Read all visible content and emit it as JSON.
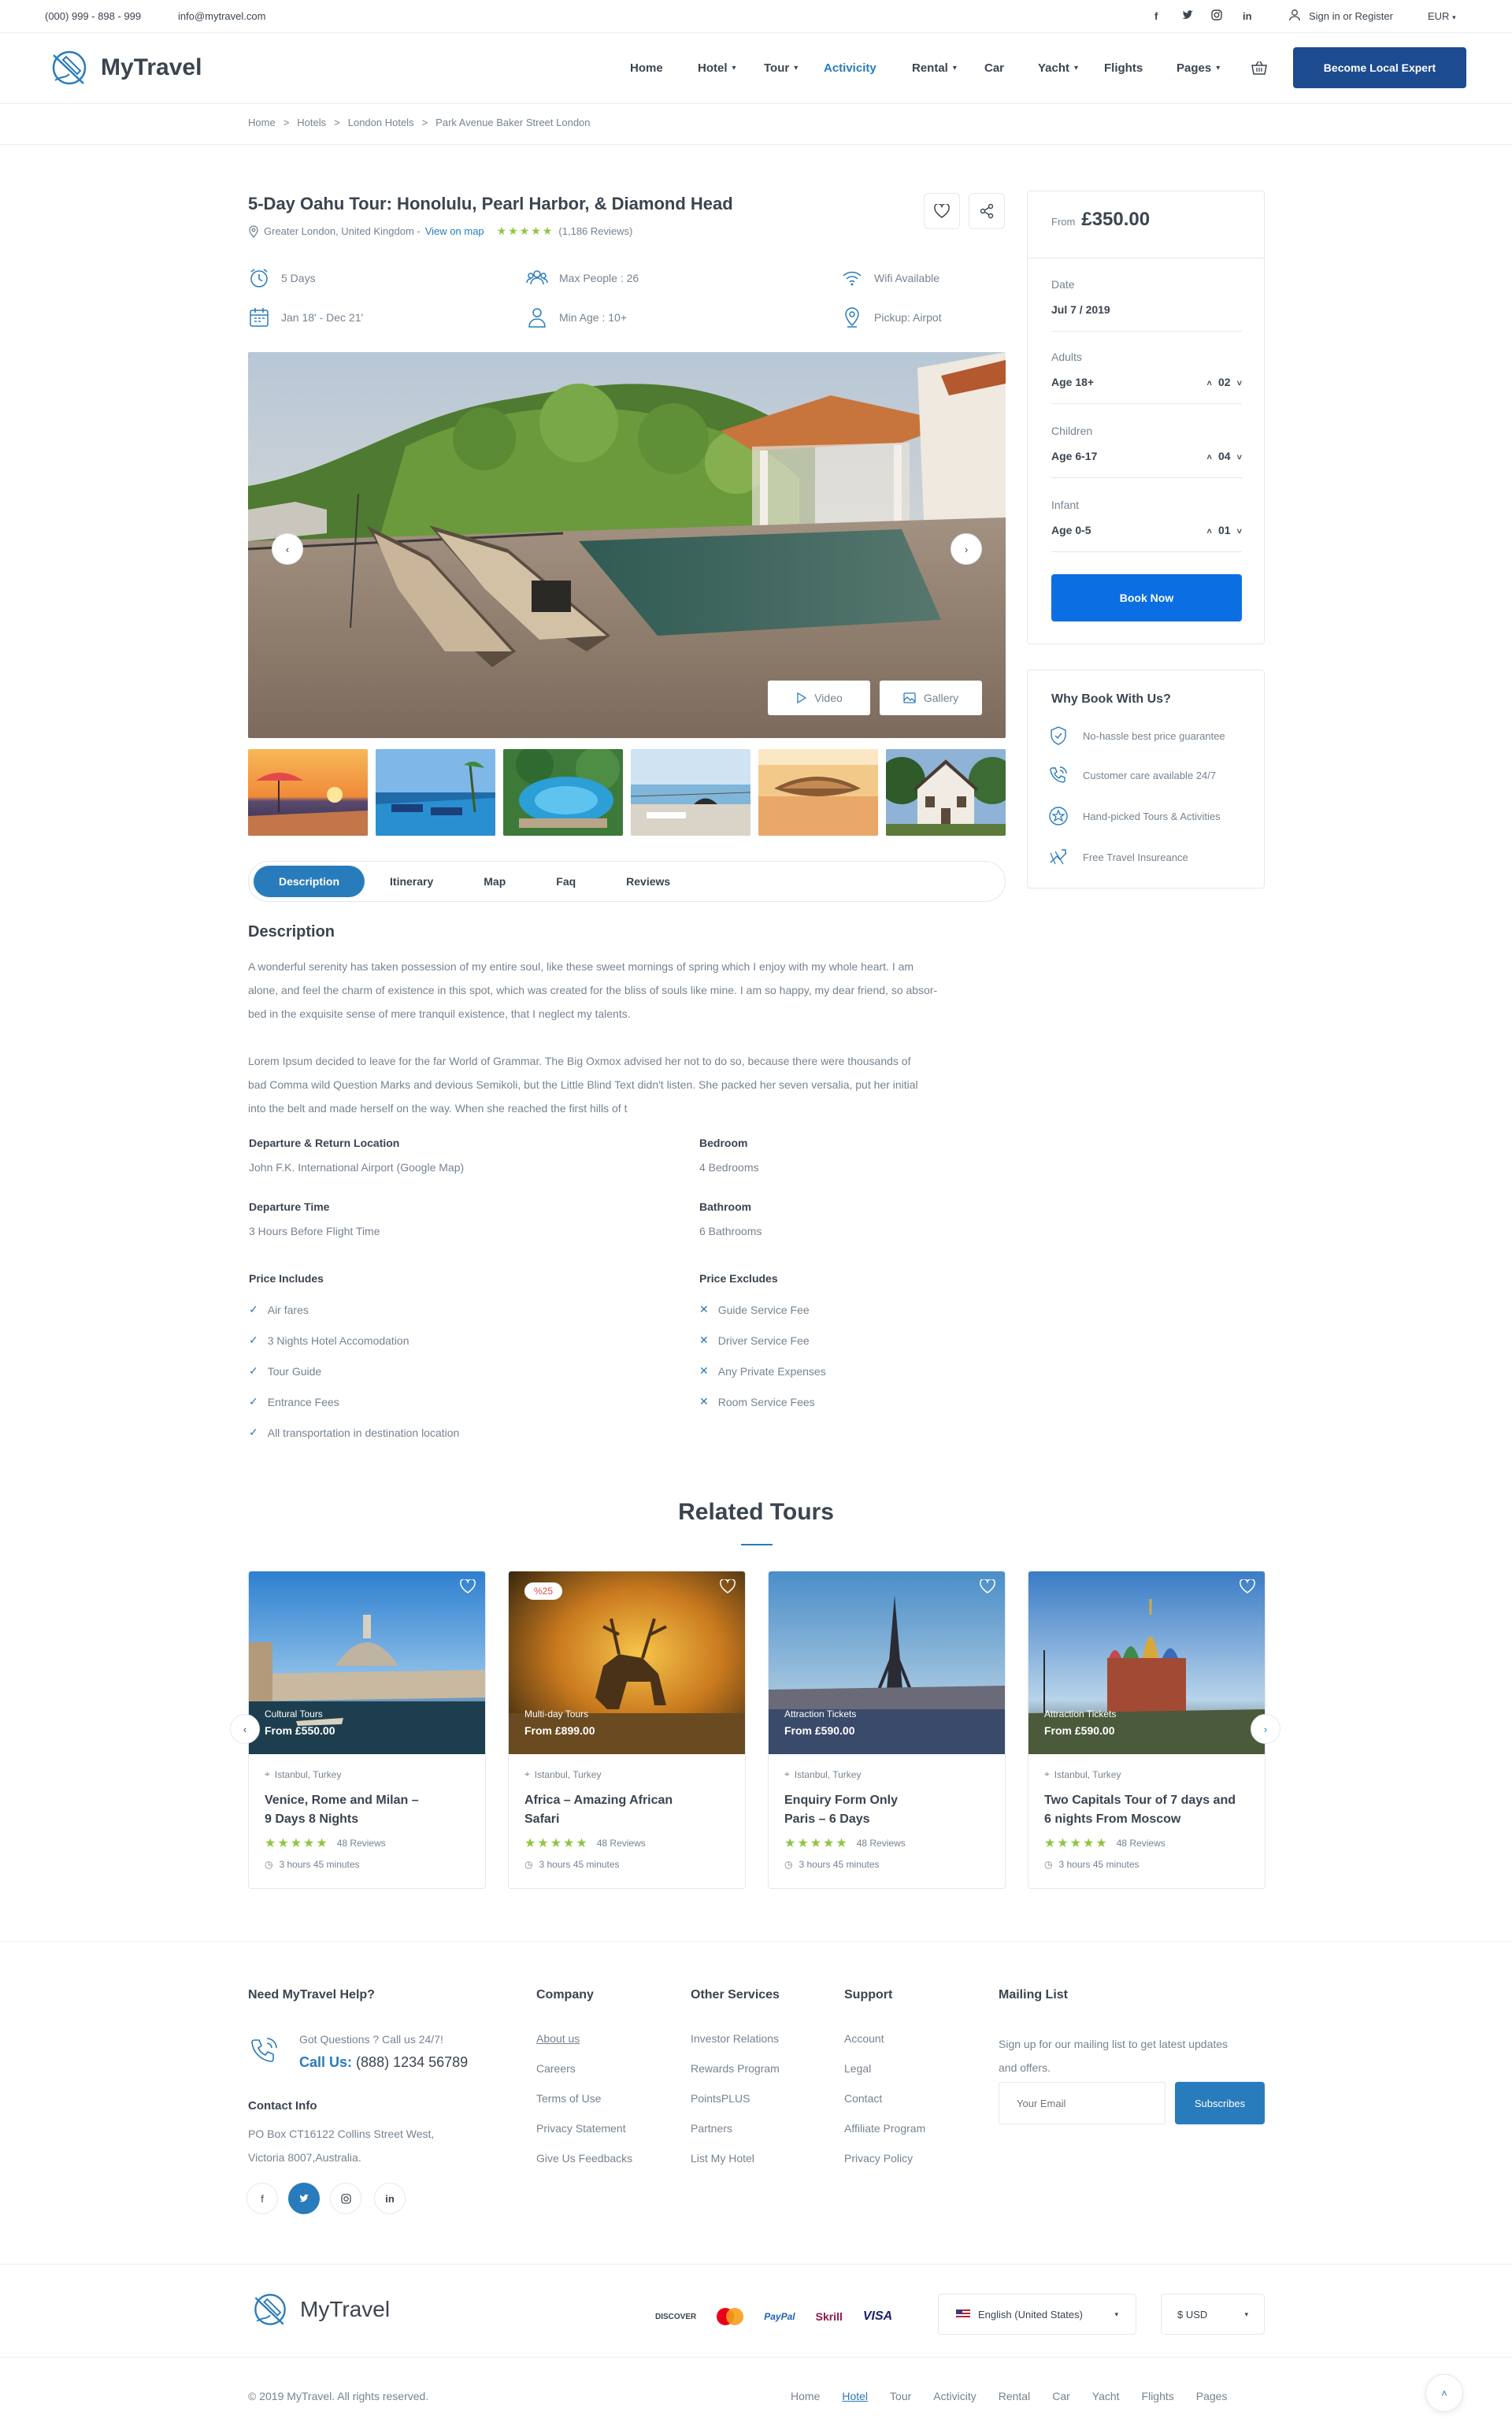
{
  "topbar": {
    "phone": "(000) 999 - 898 - 999",
    "email": "info@mytravel.com",
    "signin": "Sign in or Register",
    "currency": "EUR"
  },
  "header": {
    "logo": "MyTravel",
    "nav": [
      {
        "label": "Home"
      },
      {
        "label": "Hotel"
      },
      {
        "label": "Tour"
      },
      {
        "label": "Activicity"
      },
      {
        "label": "Rental"
      },
      {
        "label": "Car"
      },
      {
        "label": "Yacht"
      },
      {
        "label": "Flights"
      },
      {
        "label": "Pages"
      }
    ],
    "cta": "Become Local Expert"
  },
  "breadcrumb": [
    "Home",
    "Hotels",
    "London Hotels",
    "Park Avenue Baker Street London"
  ],
  "tour": {
    "title": "5-Day Oahu Tour: Honolulu, Pearl Harbor, & Diamond Head",
    "location": "Greater London, United Kingdom -",
    "view_map": "View on map",
    "reviews": "(1,186 Reviews)",
    "features": {
      "days": "5 Days",
      "people": "Max People : 26",
      "wifi": "Wifi Available",
      "dates": "Jan 18' - Dec 21'",
      "age": "Min Age : 10+",
      "pickup": "Pickup: Airpot"
    },
    "video_btn": "Video",
    "gallery_btn": "Gallery"
  },
  "tabs": [
    "Description",
    "Itinerary",
    "Map",
    "Faq",
    "Reviews"
  ],
  "description": {
    "heading": "Description",
    "para1_l1": "A wonderful serenity has taken possession of my entire soul, like these sweet mornings of spring which I enjoy with my whole heart. I am",
    "para1_l2": "alone, and feel the charm of existence in this spot, which was created for the bliss of souls like mine. I am so happy, my dear friend, so absor-",
    "para1_l3": "bed in the exquisite sense of mere tranquil existence, that I neglect my talents.",
    "para2_l1": "Lorem Ipsum decided to leave for the far World of Grammar. The Big Oxmox advised her not to do so, because there were thousands of",
    "para2_l2": "bad Comma wild Question Marks and devious Semikoli, but the Little Blind Text didn't listen. She packed her seven versalia, put her initial",
    "para2_l3": "into the belt and made herself on the way. When she reached the first hills of t",
    "departure_label": "Departure & Return Location",
    "departure_value": "John F.K. International Airport (Google Map)",
    "bedroom_label": "Bedroom",
    "bedroom_value": "4 Bedrooms",
    "dep_time_label": "Departure Time",
    "dep_time_value": "3 Hours Before Flight Time",
    "bathroom_label": "Bathroom",
    "bathroom_value": "6 Bathrooms",
    "includes_label": "Price Includes",
    "includes": [
      "Air fares",
      "3 Nights Hotel Accomodation",
      "Tour Guide",
      "Entrance Fees",
      "All transportation in destination location"
    ],
    "excludes_label": "Price Excludes",
    "excludes": [
      "Guide Service Fee",
      "Driver Service Fee",
      "Any Private Expenses",
      "Room Service Fees"
    ]
  },
  "booking": {
    "from": "From",
    "price": "£350.00",
    "date_label": "Date",
    "date_value": "Jul 7 / 2019",
    "adults_label": "Adults",
    "adults_age": "Age 18+",
    "adults_count": "02",
    "children_label": "Children",
    "children_age": "Age 6-17",
    "children_count": "04",
    "infant_label": "Infant",
    "infant_age": "Age 0-5",
    "infant_count": "01",
    "book_btn": "Book Now"
  },
  "why": {
    "title": "Why Book With Us?",
    "items": [
      "No-hassle best price guarantee",
      "Customer care available 24/7",
      "Hand-picked Tours & Activities",
      "Free Travel Insureance"
    ]
  },
  "related": {
    "title": "Related Tours",
    "cards": [
      {
        "category": "Cultural Tours",
        "price_prefix": "From",
        "price": "£550.00",
        "location": "Istanbul, Turkey",
        "title_l1": "Venice, Rome and Milan –",
        "title_l2": "9 Days 8 Nights",
        "reviews": "48 Reviews",
        "duration": "3 hours 45 minutes",
        "badge": ""
      },
      {
        "category": "Multi-day Tours",
        "price_prefix": "From",
        "price": "£899.00",
        "location": "Istanbul, Turkey",
        "title_l1": "Africa – Amazing African",
        "title_l2": "Safari",
        "reviews": "48 Reviews",
        "duration": "3 hours 45 minutes",
        "badge": "%25"
      },
      {
        "category": "Attraction Tickets",
        "price_prefix": "From",
        "price": "£590.00",
        "location": "Istanbul, Turkey",
        "title_l1": "Enquiry Form Only",
        "title_l2": "Paris – 6 Days",
        "reviews": "48 Reviews",
        "duration": "3 hours 45 minutes",
        "badge": ""
      },
      {
        "category": "Attraction Tickets",
        "price_prefix": "From",
        "price": "£590.00",
        "location": "Istanbul, Turkey",
        "title_l1": "Two Capitals Tour of 7 days and",
        "title_l2": "6 nights From Moscow",
        "reviews": "48 Reviews",
        "duration": "3 hours 45 minutes",
        "badge": ""
      }
    ]
  },
  "footer": {
    "help_title": "Need MyTravel Help?",
    "questions": "Got Questions ? Call us 24/7!",
    "call_label": "Call Us:",
    "call_number": "(888) 1234 56789",
    "contact_title": "Contact Info",
    "address_l1": "PO Box CT16122 Collins Street West,",
    "address_l2": "Victoria 8007,Australia.",
    "company_title": "Company",
    "company": [
      "About us",
      "Careers",
      "Terms of Use",
      "Privacy Statement",
      "Give Us Feedbacks"
    ],
    "services_title": "Other Services",
    "services": [
      "Investor Relations",
      "Rewards Program",
      "PointsPLUS",
      "Partners",
      "List My Hotel"
    ],
    "support_title": "Support",
    "support": [
      "Account",
      "Legal",
      "Contact",
      "Affiliate Program",
      "Privacy Policy"
    ],
    "mailing_title": "Mailing List",
    "mailing_l1": "Sign up for our mailing list to get latest updates",
    "mailing_l2": "and offers.",
    "email_placeholder": "Your Email",
    "subscribe": "Subscribes",
    "logo": "MyTravel",
    "payments": [
      "DISCOVER",
      "mastercard",
      "PayPal",
      "Skrill",
      "VISA"
    ],
    "language": "English (United States)",
    "currency": "$ USD",
    "copyright": "© 2019 MyTravel. All rights reserved.",
    "links": [
      "Home",
      "Hotel",
      "Tour",
      "Activicity",
      "Rental",
      "Car",
      "Yacht",
      "Flights",
      "Pages"
    ]
  }
}
